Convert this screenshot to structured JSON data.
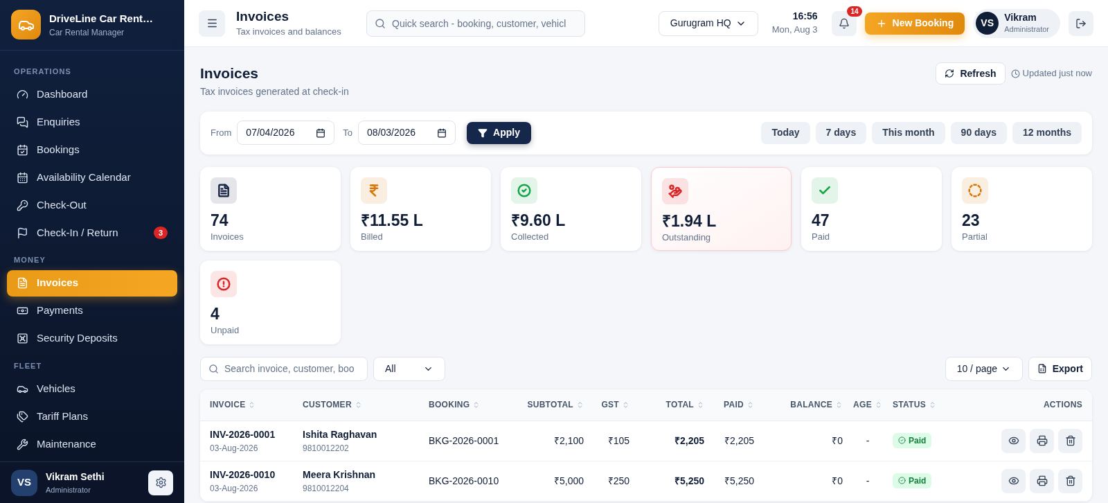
{
  "brand": {
    "name": "DriveLine Car Rent…",
    "subtitle": "Car Rental Manager"
  },
  "sidebar": {
    "sections": [
      {
        "label": "OPERATIONS",
        "items": [
          {
            "label": "Dashboard",
            "selected": false
          },
          {
            "label": "Enquiries",
            "selected": false
          },
          {
            "label": "Bookings",
            "selected": false
          },
          {
            "label": "Availability Calendar",
            "selected": false
          },
          {
            "label": "Check-Out",
            "selected": false
          },
          {
            "label": "Check-In / Return",
            "selected": false,
            "badge": "3"
          }
        ]
      },
      {
        "label": "MONEY",
        "items": [
          {
            "label": "Invoices",
            "selected": true
          },
          {
            "label": "Payments",
            "selected": false
          },
          {
            "label": "Security Deposits",
            "selected": false
          }
        ]
      },
      {
        "label": "FLEET",
        "items": [
          {
            "label": "Vehicles",
            "selected": false
          },
          {
            "label": "Tariff Plans",
            "selected": false
          },
          {
            "label": "Maintenance",
            "selected": false
          }
        ]
      }
    ],
    "user": {
      "initials": "VS",
      "name": "Vikram Sethi",
      "role": "Administrator"
    }
  },
  "header": {
    "title": "Invoices",
    "subtitle": "Tax invoices and balances",
    "search": {
      "placeholder": "Quick search - booking, customer, vehicl"
    },
    "branch": "Gurugram HQ",
    "time": "16:56",
    "date": "Mon, Aug 3",
    "notifications": "14",
    "new_booking": "New Booking",
    "user": {
      "initials": "VS",
      "name": "Vikram",
      "role": "Administrator"
    }
  },
  "page": {
    "title": "Invoices",
    "subtitle": "Tax invoices generated at check-in",
    "refresh": "Refresh",
    "updated": "Updated just now"
  },
  "filters": {
    "from_label": "From",
    "from": "07/04/2026",
    "to_label": "To",
    "to": "08/03/2026",
    "apply": "Apply",
    "ranges": [
      {
        "label": "Today",
        "selected": false
      },
      {
        "label": "7 days",
        "selected": false
      },
      {
        "label": "This month",
        "selected": false
      },
      {
        "label": "90 days",
        "selected": false
      },
      {
        "label": "12 months",
        "selected": false
      }
    ]
  },
  "stats": [
    {
      "value": "74",
      "label": "Invoices",
      "color": "#1e2a4a",
      "highlighted": false
    },
    {
      "value": "₹11.55 L",
      "label": "Billed",
      "color": "#d97706",
      "highlighted": false
    },
    {
      "value": "₹9.60 L",
      "label": "Collected",
      "color": "#16a34a",
      "highlighted": false
    },
    {
      "value": "₹1.94 L",
      "label": "Outstanding",
      "color": "#dc2626",
      "highlighted": true
    },
    {
      "value": "47",
      "label": "Paid",
      "color": "#16a34a",
      "highlighted": false
    },
    {
      "value": "23",
      "label": "Partial",
      "color": "#d97706",
      "highlighted": false
    },
    {
      "value": "4",
      "label": "Unpaid",
      "color": "#dc2626",
      "highlighted": false
    }
  ],
  "table_toolbar": {
    "search": {
      "placeholder": "Search invoice, customer, boo"
    },
    "status_filter": "All",
    "page_size": "10 / page",
    "export": "Export"
  },
  "table": {
    "columns": [
      "INVOICE",
      "CUSTOMER",
      "BOOKING",
      "SUBTOTAL",
      "GST",
      "TOTAL",
      "PAID",
      "BALANCE",
      "AGE",
      "STATUS",
      "ACTIONS"
    ],
    "rows": [
      {
        "invoice": "INV-2026-0001",
        "date": "03-Aug-2026",
        "customer": "Ishita Raghavan",
        "phone": "9810012202",
        "booking": "BKG-2026-0001",
        "subtotal": "₹2,100",
        "gst": "₹105",
        "total": "₹2,205",
        "paid": "₹2,205",
        "balance": "₹0",
        "age": "-",
        "status": {
          "label": "Paid",
          "kind": "paid"
        }
      },
      {
        "invoice": "INV-2026-0010",
        "date": "03-Aug-2026",
        "customer": "Meera Krishnan",
        "phone": "9810012204",
        "booking": "BKG-2026-0010",
        "subtotal": "₹5,000",
        "gst": "₹250",
        "total": "₹5,250",
        "paid": "₹5,250",
        "balance": "₹0",
        "age": "-",
        "status": {
          "label": "Paid",
          "kind": "paid"
        }
      }
    ]
  }
}
